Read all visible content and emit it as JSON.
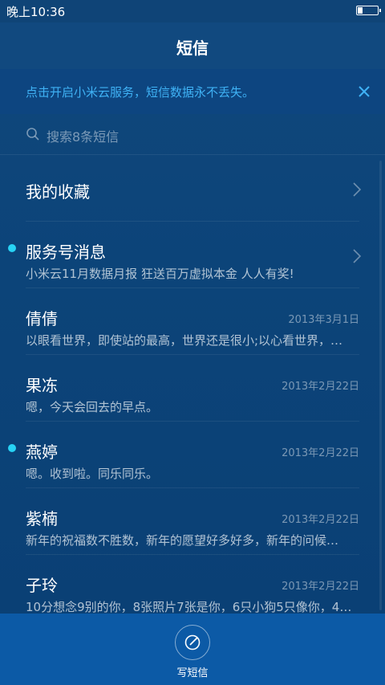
{
  "status_bar": {
    "time": "晚上10:36"
  },
  "header": {
    "title": "短信"
  },
  "banner": {
    "text": "点击开启小米云服务，短信数据永不丢失。"
  },
  "search": {
    "placeholder": "搜索8条短信"
  },
  "conversations": [
    {
      "name": "我的收藏",
      "preview": "",
      "date": "",
      "unread": false
    },
    {
      "name": "服务号消息",
      "preview": "小米云11月数据月报 狂送百万虚拟本金 人人有奖!",
      "date": "",
      "unread": true
    },
    {
      "name": "倩倩",
      "preview": "以眼看世界，即使站的最高，世界还是很小;以心看世界，…",
      "date": "2013年3月1日",
      "unread": false
    },
    {
      "name": "果冻",
      "preview": "嗯，今天会回去的早点。",
      "date": "2013年2月22日",
      "unread": false
    },
    {
      "name": "燕婷",
      "preview": "嗯。收到啦。同乐同乐。",
      "date": "2013年2月22日",
      "unread": true
    },
    {
      "name": "紫楠",
      "preview": "新年的祝福数不胜数，新年的愿望好多好多，新年的问候…",
      "date": "2013年2月22日",
      "unread": false
    },
    {
      "name": "子玲",
      "preview": "10分想念9别的你，8张照片7张是你，6只小狗5只像你，4…",
      "date": "2013年2月22日",
      "unread": false
    }
  ],
  "bottom_bar": {
    "compose_label": "写短信"
  },
  "colors": {
    "background": "#0c4479",
    "accent": "#3fb2f5",
    "unread_dot": "#27d3f5",
    "bottom_bar": "#0c5aa6"
  }
}
